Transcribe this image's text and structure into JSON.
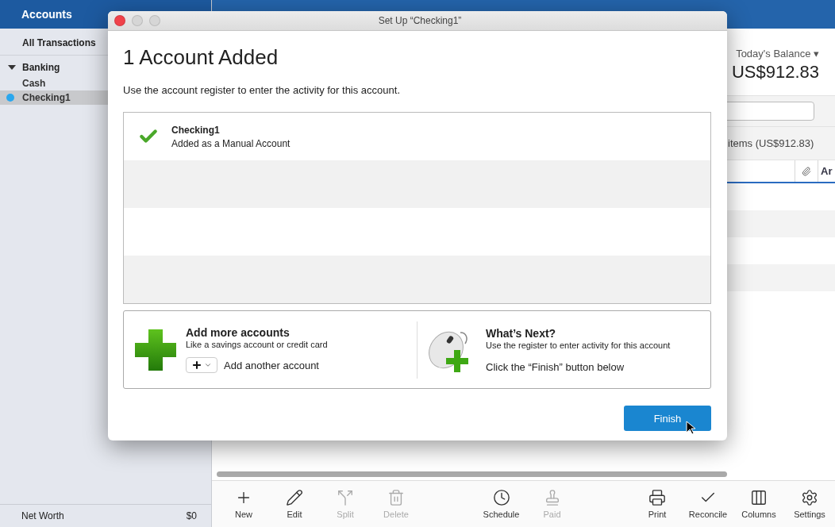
{
  "sidebar": {
    "title": "Accounts",
    "all_transactions": "All Transactions",
    "groups": [
      {
        "label": "Banking",
        "expanded": true,
        "children": [
          {
            "label": "Cash",
            "selected": false
          },
          {
            "label": "Checking1",
            "selected": true,
            "color": "#2aa7ee"
          }
        ]
      }
    ],
    "footer": {
      "label": "Net Worth",
      "value": "$0"
    }
  },
  "register": {
    "balance_label": "Today's Balance ▾",
    "balance": "US$912.83",
    "summary": "items (US$912.83)",
    "columns": [
      {
        "kind": "attachment"
      },
      {
        "kind": "text",
        "label": "Ar"
      }
    ]
  },
  "toolbar": {
    "groups": [
      [
        {
          "label": "New",
          "disabled": false
        },
        {
          "label": "Edit",
          "disabled": false
        },
        {
          "label": "Split",
          "disabled": true
        },
        {
          "label": "Delete",
          "disabled": true
        }
      ],
      [
        {
          "label": "Schedule",
          "disabled": false
        },
        {
          "label": "Paid",
          "disabled": true
        }
      ],
      [
        {
          "label": "Print",
          "disabled": false
        },
        {
          "label": "Reconcile",
          "disabled": false
        },
        {
          "label": "Columns",
          "disabled": false
        },
        {
          "label": "Settings",
          "disabled": false
        }
      ]
    ]
  },
  "dialog": {
    "title": "Set Up “Checking1”",
    "heading": "1 Account Added",
    "intro": "Use the account register to enter the activity for this account.",
    "accounts": [
      {
        "name": "Checking1",
        "status": "Added as a Manual Account"
      }
    ],
    "add_more": {
      "title": "Add more accounts",
      "subtitle": "Like a savings account or credit card",
      "action": "Add another account"
    },
    "next": {
      "title": "What’s Next?",
      "subtitle": "Use the register to enter activity for this account",
      "hint": "Click the “Finish” button below"
    },
    "finish": "Finish"
  }
}
